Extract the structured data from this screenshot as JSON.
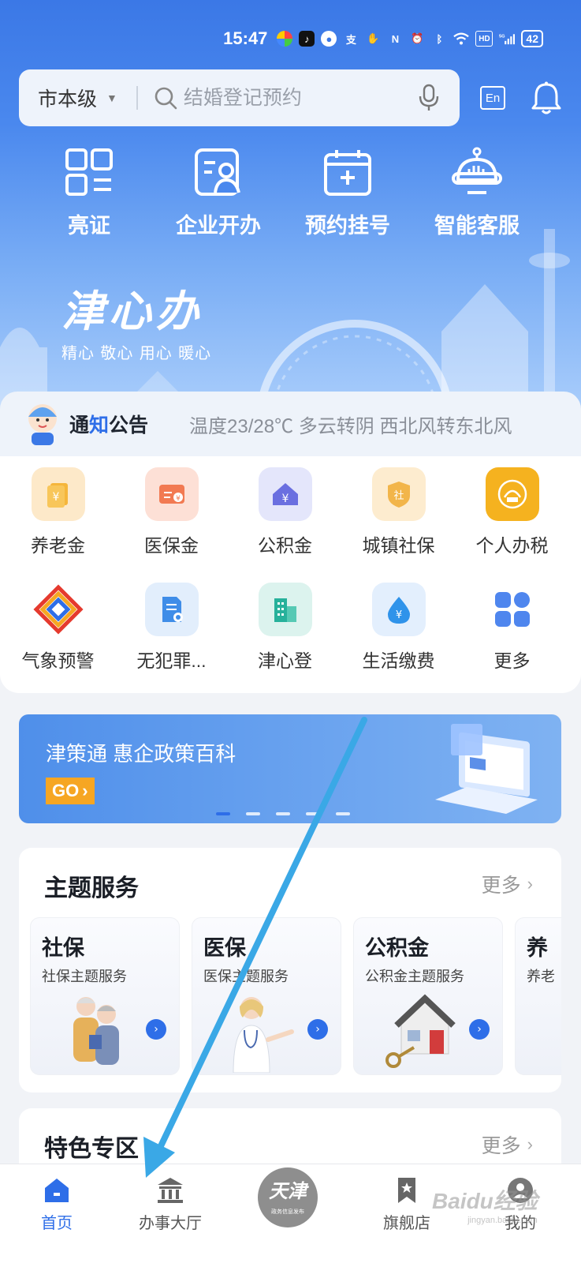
{
  "status_bar": {
    "time": "15:47",
    "network": "5G",
    "battery": "42"
  },
  "search": {
    "region": "市本级",
    "placeholder": "结婚登记预约",
    "en_label": "En"
  },
  "quick_actions": [
    {
      "label": "亮证",
      "icon": "qr-code-icon"
    },
    {
      "label": "企业开办",
      "icon": "enterprise-card-icon"
    },
    {
      "label": "预约挂号",
      "icon": "calendar-plus-icon"
    },
    {
      "label": "智能客服",
      "icon": "robot-icon"
    }
  ],
  "brand": {
    "logo": "津心办",
    "slogan": "精心 敬心 用心 暖心"
  },
  "notice": {
    "title_prefix": "通",
    "title_accent": "知",
    "title_suffix": "公告",
    "text": "温度23/28℃ 多云转阴 西北风转东北风"
  },
  "services": [
    {
      "label": "养老金",
      "icon": "pension-icon",
      "color": "#fde9c9"
    },
    {
      "label": "医保金",
      "icon": "medical-insurance-icon",
      "color": "#fde0d6"
    },
    {
      "label": "公积金",
      "icon": "housing-fund-icon",
      "color": "#e4e6fb"
    },
    {
      "label": "城镇社保",
      "icon": "social-security-icon",
      "color": "#fdeccf"
    },
    {
      "label": "个人办税",
      "icon": "tax-icon",
      "color": "#f5b21f"
    },
    {
      "label": "气象预警",
      "icon": "weather-warning-icon",
      "color": "#ffffff"
    },
    {
      "label": "无犯罪...",
      "icon": "no-crime-certificate-icon",
      "color": "#e2eefc"
    },
    {
      "label": "津心登",
      "icon": "building-icon",
      "color": "#dcf3ee"
    },
    {
      "label": "生活缴费",
      "icon": "utility-payment-icon",
      "color": "#e3effd"
    },
    {
      "label": "更多",
      "icon": "more-grid-icon",
      "color": "#ffffff"
    }
  ],
  "banner": {
    "title": "津策通 惠企政策百科",
    "cta": "GO",
    "cta_arrow": "›",
    "pages": 5,
    "active_page": 1
  },
  "theme_services": {
    "title": "主题服务",
    "more": "更多",
    "cards": [
      {
        "title": "社保",
        "subtitle": "社保主题服务"
      },
      {
        "title": "医保",
        "subtitle": "医保主题服务"
      },
      {
        "title": "公积金",
        "subtitle": "公积金主题服务"
      },
      {
        "title": "养",
        "subtitle": "养老"
      }
    ]
  },
  "featured": {
    "title": "特色专区",
    "more": "更多"
  },
  "tabbar": {
    "items": [
      {
        "label": "首页",
        "active": true
      },
      {
        "label": "办事大厅",
        "active": false
      },
      {
        "label": "旗舰店",
        "active": false
      },
      {
        "label": "我的",
        "active": false
      }
    ],
    "center_logo": "天津",
    "center_caption": "政务信息发布"
  },
  "watermark": {
    "main": "Baidu经验",
    "sub": "jingyan.baidu.com"
  },
  "colors": {
    "primary": "#2e6ee8",
    "hero_top": "#3b78e6",
    "go_orange": "#f6a623",
    "arrow": "#3aa8e6"
  }
}
